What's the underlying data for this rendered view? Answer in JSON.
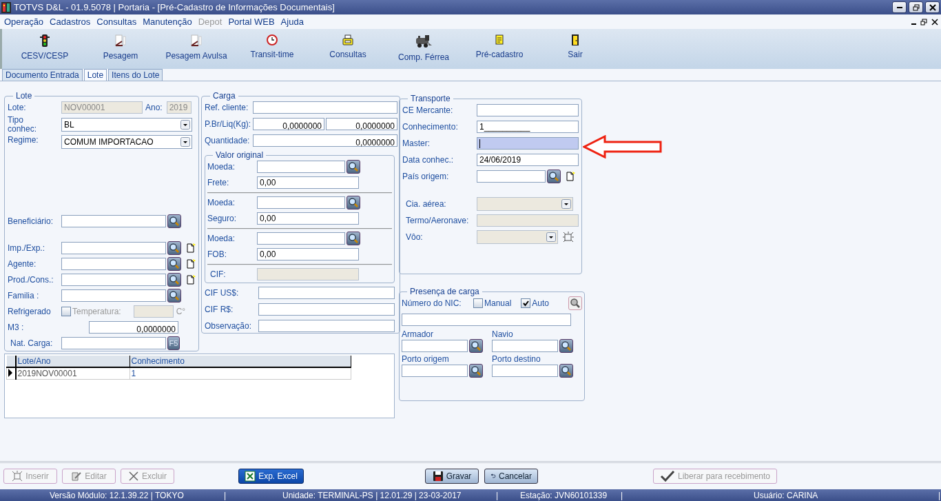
{
  "window": {
    "title": "TOTVS D&L - 01.9.5078 | Portaria - [Pré-Cadastro de Informações Documentais]"
  },
  "menu": [
    {
      "label": "Operação",
      "disabled": false
    },
    {
      "label": "Cadastros",
      "disabled": false
    },
    {
      "label": "Consultas",
      "disabled": false
    },
    {
      "label": "Manutenção",
      "disabled": false
    },
    {
      "label": "Depot",
      "disabled": true
    },
    {
      "label": "Portal WEB",
      "disabled": false
    },
    {
      "label": "Ajuda",
      "disabled": false
    }
  ],
  "toolbar": [
    {
      "label": "CESV/CESP",
      "kind": "traffic"
    },
    {
      "label": "Pesagem",
      "kind": "scale"
    },
    {
      "label": "Pesagem Avulsa",
      "kind": "scale"
    },
    {
      "label": "Transit-time",
      "kind": "clock"
    },
    {
      "label": "Consultas",
      "kind": "printer"
    },
    {
      "label": "Comp. Férrea",
      "kind": "locomotive"
    },
    {
      "label": "Pré-cadastro",
      "kind": "document"
    },
    {
      "label": "Sair",
      "kind": "door"
    }
  ],
  "tabs": [
    {
      "label": "Documento Entrada",
      "selected": false
    },
    {
      "label": "Lote",
      "selected": true
    },
    {
      "label": "Itens do Lote",
      "selected": false
    }
  ],
  "lote": {
    "title": "Lote",
    "lote": {
      "label": "Lote:",
      "value": "NOV00001"
    },
    "ano": {
      "label": "Ano:",
      "value": "2019"
    },
    "tipo": {
      "label": "Tipo conhec:",
      "value": "BL"
    },
    "regime": {
      "label": "Regime:",
      "value": "COMUM IMPORTACAO"
    },
    "beneficiario": {
      "label": "Beneficiário:"
    },
    "parties": [
      {
        "label": "Imp./Exp.:",
        "new": true
      },
      {
        "label": "Agente:",
        "new": true
      },
      {
        "label": "Prod./Cons.:",
        "new": true
      },
      {
        "label": "Familia :",
        "new": false
      }
    ],
    "refrigerado": {
      "label": "Refrigerado",
      "checked": false,
      "temp_label": "Temperatura:",
      "unit": "C°"
    },
    "m3": {
      "label": "M3  :",
      "value": "0,0000000"
    },
    "nat_carga": {
      "label": "Nat. Carga:",
      "key": "F5"
    }
  },
  "carga": {
    "title": "Carga",
    "ref_cliente": {
      "label": "Ref. cliente:"
    },
    "peso": {
      "label": "P.Br/Liq(Kg):",
      "bruto": "0,0000000",
      "liquido": "0,0000000"
    },
    "quantidade": {
      "label": "Quantidade:",
      "value": "0,0000000"
    },
    "valor_original": {
      "title": "Valor original",
      "items": [
        {
          "moeda_label": "Moeda:",
          "label": "Frete:",
          "value": "0,00"
        },
        {
          "moeda_label": "Moeda:",
          "label": "Seguro:",
          "value": "0,00"
        },
        {
          "moeda_label": "Moeda:",
          "label": "FOB:",
          "value": "0,00"
        }
      ],
      "cif": {
        "label": "CIF:"
      }
    },
    "totals": [
      {
        "label": "CIF  US$:"
      },
      {
        "label": "CIF  R$:"
      },
      {
        "label": "Observação:"
      }
    ]
  },
  "transporte": {
    "title": "Transporte",
    "fields": [
      {
        "kind": "text",
        "label": "CE Mercante:",
        "focused": false,
        "disabled": false
      },
      {
        "kind": "text",
        "label": "Conhecimento:",
        "value": "1__________",
        "focused": false,
        "disabled": false
      },
      {
        "kind": "text",
        "label": "Master:",
        "focused": true,
        "disabled": false
      },
      {
        "kind": "text",
        "label": "Data conhec.:",
        "value": "24/06/2019",
        "focused": false,
        "disabled": false
      },
      {
        "kind": "lookup",
        "label": "País origem:",
        "focused": false,
        "disabled": false
      },
      {
        "kind": "select",
        "label": "Cia. aérea:",
        "focused": false,
        "disabled": true
      },
      {
        "kind": "text",
        "label": "Termo/Aeronave:",
        "focused": false,
        "disabled": true
      },
      {
        "kind": "select-add",
        "label": "Vôo:",
        "focused": false,
        "disabled": true
      }
    ]
  },
  "presenca": {
    "title": "Presença de carga",
    "nic_label": "Número do NIC:",
    "options": [
      {
        "label": "Manual",
        "checked": false
      },
      {
        "label": "Auto",
        "checked": true
      }
    ],
    "lookups": [
      {
        "label": "Armador"
      },
      {
        "label": "Navio"
      },
      {
        "label": "Porto origem"
      },
      {
        "label": "Porto destino"
      }
    ]
  },
  "grid": {
    "columns": [
      "Lote/Ano",
      "Conhecimento"
    ],
    "rows": [
      {
        "cells": [
          "2019NOV00001",
          "1"
        ],
        "selected": true
      }
    ]
  },
  "buttons": [
    {
      "label": "Inserir",
      "kind": "insert",
      "disabled": true
    },
    {
      "label": "Editar",
      "kind": "edit",
      "disabled": true
    },
    {
      "label": "Excluir",
      "kind": "delete",
      "disabled": true
    },
    {
      "label": "Exp. Excel",
      "kind": "excel",
      "disabled": false
    },
    {
      "label": "Gravar",
      "kind": "save",
      "disabled": false
    },
    {
      "label": "Cancelar",
      "kind": "undo",
      "disabled": false
    },
    {
      "label": "Liberar para recebimento",
      "kind": "check",
      "disabled": true
    }
  ],
  "status_bar": [
    "Versão Módulo:  12.1.39.22  |  TOKYO",
    "|",
    "Unidade: TERMINAL-PS | 12.01.29 | 23-03-2017",
    "|",
    "Estação: JVN60101339",
    "|",
    "Usuário: CARINA",
    "|"
  ]
}
